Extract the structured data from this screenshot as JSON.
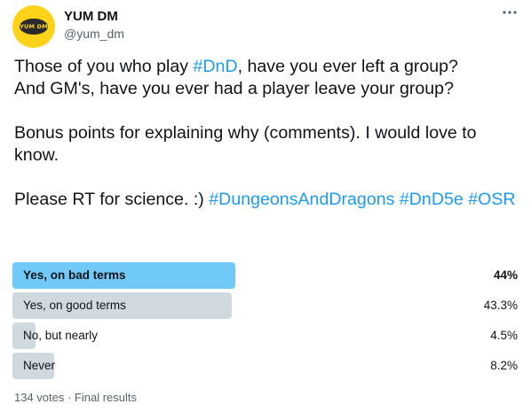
{
  "author": {
    "display_name": "YUM DM",
    "handle": "@yum_dm",
    "avatar_text": "YUM DM",
    "avatar_color": "#ffd21a"
  },
  "more_icon": "more-horizontal-icon",
  "tweet": {
    "line1_a": "Those of you who play ",
    "line1_tag": "#DnD",
    "line1_b": ", have you ever left a group?",
    "line2": "And GM's, have you ever had a player leave your group?",
    "para2": "Bonus points for explaining why (comments). I would love to know.",
    "para3_a": "Please RT for science. :) ",
    "tag_dd": "#DungeonsAndDragons",
    "tag_dnd5e": "#DnD5e",
    "tag_osr": "#OSR"
  },
  "poll": {
    "options": [
      {
        "label": "Yes, on bad terms",
        "percent_text": "44%",
        "percent": 44,
        "winner": true
      },
      {
        "label": "Yes, on good terms",
        "percent_text": "43.3%",
        "percent": 43.3,
        "winner": false
      },
      {
        "label": "No, but nearly",
        "percent_text": "4.5%",
        "percent": 4.5,
        "winner": false
      },
      {
        "label": "Never",
        "percent_text": "8.2%",
        "percent": 8.2,
        "winner": false
      }
    ],
    "footer": "134 votes · Final results"
  },
  "colors": {
    "link": "#1d9bf0",
    "winner_bar": "#71c9f8",
    "other_bar": "#cfd9de",
    "muted_text": "#536471"
  }
}
